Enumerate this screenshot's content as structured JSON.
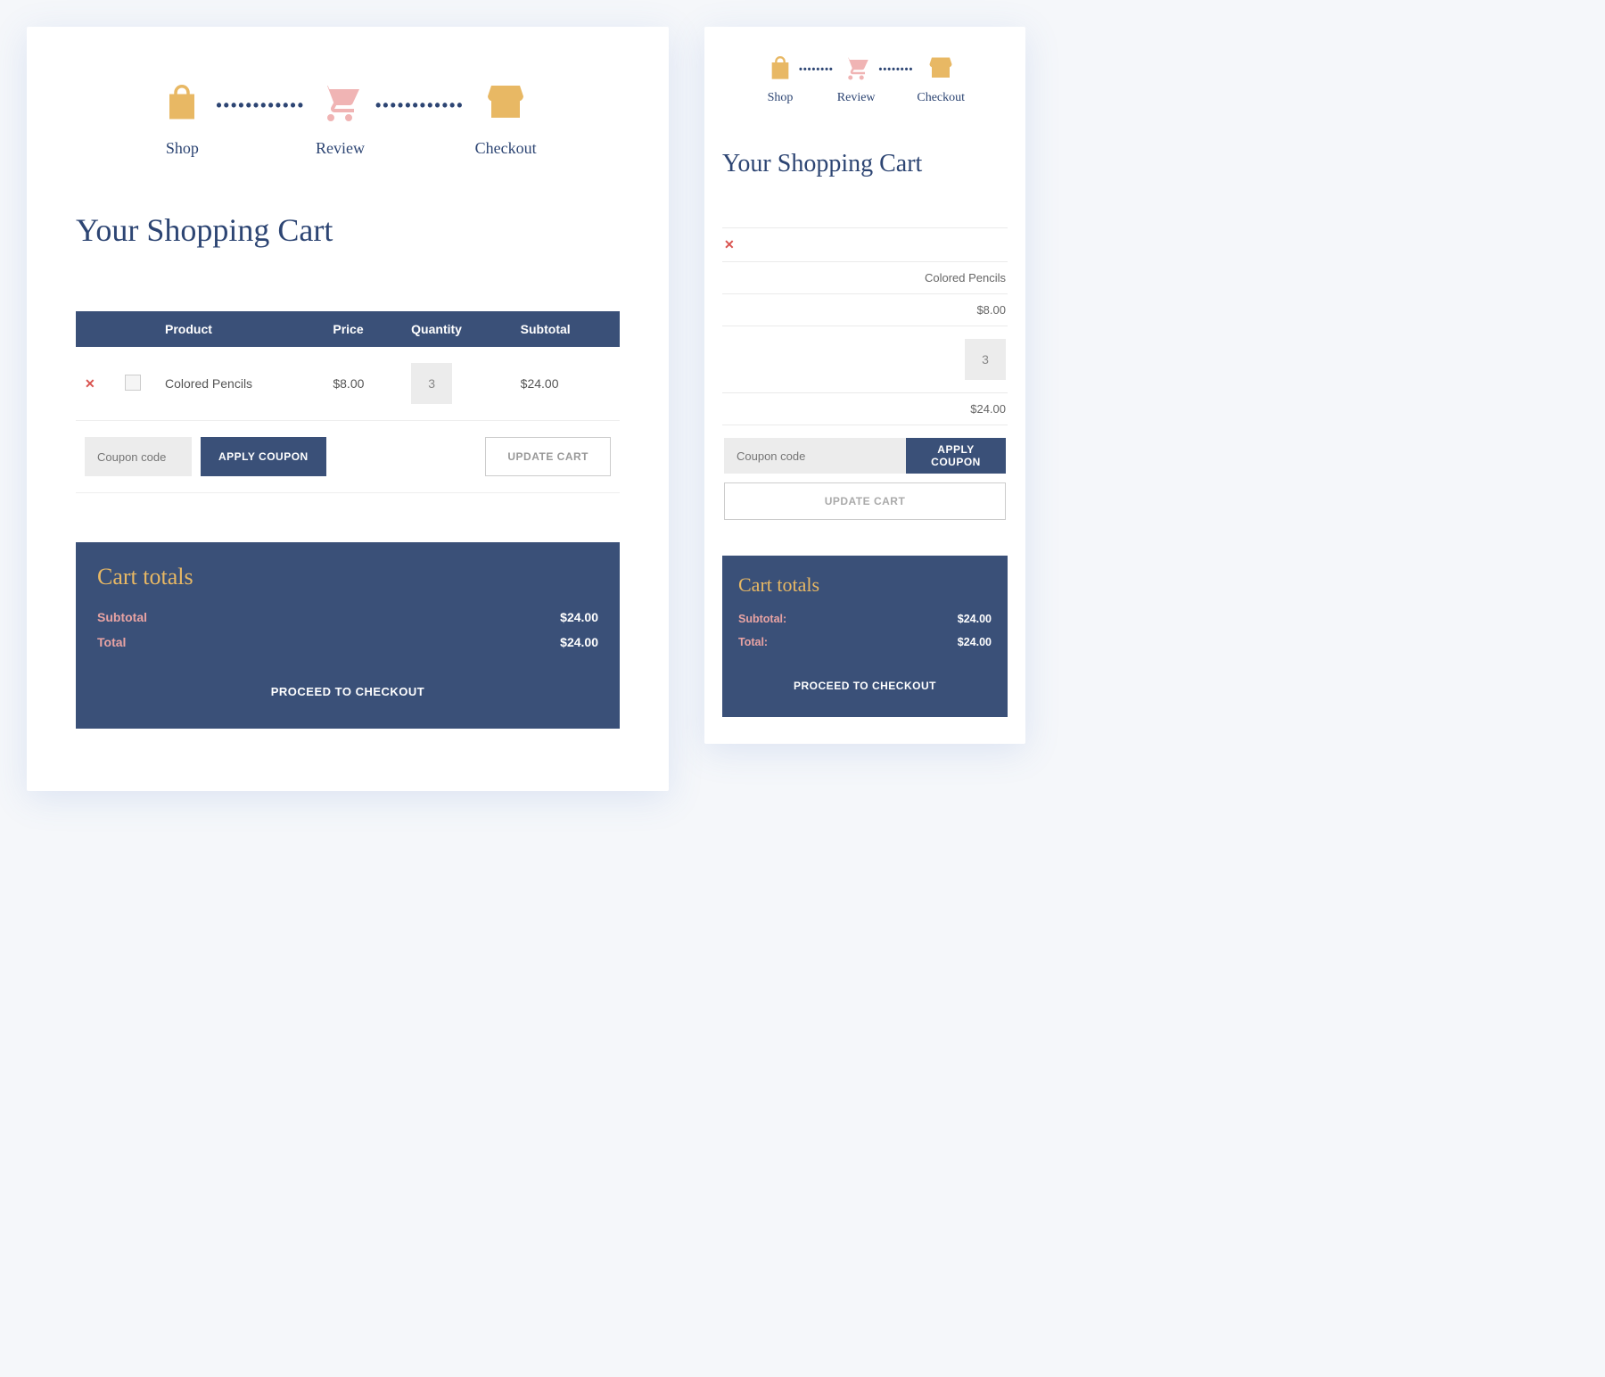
{
  "steps": {
    "shop": {
      "label": "Shop"
    },
    "review": {
      "label": "Review"
    },
    "checkout": {
      "label": "Checkout"
    }
  },
  "heading": "Your Shopping Cart",
  "table": {
    "headers": {
      "product": "Product",
      "price": "Price",
      "quantity": "Quantity",
      "subtotal": "Subtotal"
    },
    "item": {
      "name": "Colored Pencils",
      "price": "$8.00",
      "qty": "3",
      "subtotal": "$24.00"
    }
  },
  "coupon": {
    "placeholder": "Coupon code",
    "apply": "APPLY COUPON"
  },
  "update": "UPDATE CART",
  "totals": {
    "title": "Cart totals",
    "subtotal_label": "Subtotal",
    "subtotal_label_m": "Subtotal:",
    "subtotal_value": "$24.00",
    "total_label": "Total",
    "total_label_m": "Total:",
    "total_value": "$24.00",
    "checkout": "PROCEED TO CHECKOUT"
  }
}
